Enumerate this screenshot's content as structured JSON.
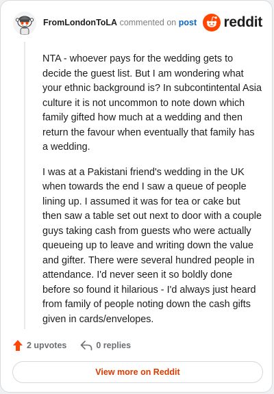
{
  "header": {
    "username": "FromLondonToLA",
    "action_text": "commented on",
    "post_link": "post",
    "brand": "reddit"
  },
  "comment": {
    "paragraphs": [
      "NTA - whoever pays for the wedding gets to decide the guest list. But I am wondering what your ethnic background is? In subcontintental Asia culture it is not uncommon to note down which family gifted how much at a wedding and then return the favour when eventually that family has a wedding.",
      "I was at a Pakistani friend's wedding in the UK when towards the end I saw a queue of people lining up. I assumed it was for tea or cake but then saw a table set out next to door with a couple guys taking cash from guests who were actually queueing up to leave and writing down the value and gifter. There were several hundred people in attendance. I'd never seen it so boldly done before so found it hilarious - I'd always just heard from family of people noting down the cash gifts given in cards/envelopes."
    ]
  },
  "footer": {
    "upvotes": "2 upvotes",
    "replies": "0 replies",
    "view_more": "View more on Reddit"
  },
  "icons": {
    "avatar": "snoo-avatar-icon",
    "brand": "reddit-logo-icon",
    "upvote": "upvote-arrow-icon",
    "reply": "reply-arrow-icon"
  },
  "colors": {
    "brand_orange": "#ff4500",
    "link_blue": "#0a66c2",
    "view_more_text": "#d93a00",
    "upvote_arrow": "#ff4500"
  }
}
